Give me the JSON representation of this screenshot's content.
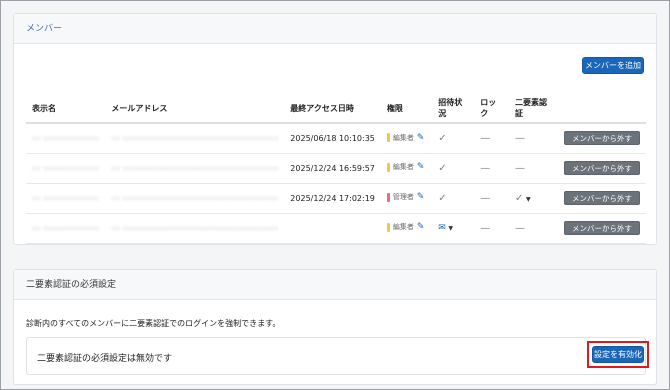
{
  "members_card": {
    "title": "メンバー",
    "add_button_label": "メンバーを追加",
    "columns": [
      "表示名",
      "メールアドレス",
      "最終アクセス日時",
      "権限",
      "招待状況",
      "ロック",
      "二要素認証"
    ],
    "rows": [
      {
        "name": "•• •••••••••••••",
        "email": "•• ••••••••••••••••••••••••••••••••••••",
        "last_access": "2025/06/18 10:10:35",
        "role": "編集者",
        "role_color": "#f2c744",
        "invite": "check",
        "lock": "dash",
        "twofa": "dash",
        "remove_label": "メンバーから外す"
      },
      {
        "name": "•• •••••••••••••",
        "email": "•• ••••••••••••••••••••••••••••••••••••",
        "last_access": "2025/12/24 16:59:57",
        "role": "編集者",
        "role_color": "#f2c744",
        "invite": "check",
        "lock": "dash",
        "twofa": "dash",
        "remove_label": "メンバーから外す"
      },
      {
        "name": "•• •••••••••••••",
        "email": "•• ••••••••••••••••••••••••••••••••••••",
        "last_access": "2025/12/24 17:02:19",
        "role": "管理者",
        "role_color": "#e8707a",
        "invite": "check",
        "lock": "dash",
        "twofa": "check-dropdown",
        "remove_label": "メンバーから外す"
      },
      {
        "name": "•• •••••••••••••",
        "email": "•• ••••••••••••••••••••••••••••••••••••",
        "last_access": "",
        "role": "編集者",
        "role_color": "#f2c744",
        "invite": "mail-dropdown",
        "lock": "dash",
        "twofa": "dash",
        "remove_label": "メンバーから外す"
      }
    ]
  },
  "twofa_card": {
    "title": "二要素認証の必須設定",
    "description": "診断内のすべてのメンバーに二要素認証でのログインを強制できます。",
    "status_text": "二要素認証の必須設定は無効です",
    "enable_button_label": "設定を有効化",
    "highlight_color": "#e0191f"
  }
}
